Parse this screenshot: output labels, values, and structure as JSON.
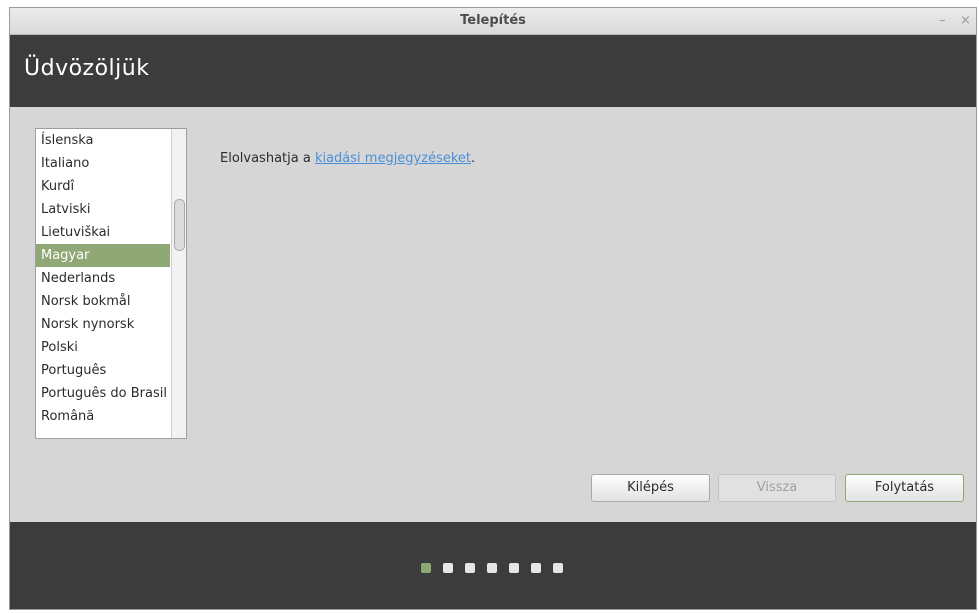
{
  "window": {
    "title": "Telepítés",
    "minimize_glyph": "–",
    "close_glyph": "×"
  },
  "header": {
    "heading": "Üdvözöljük"
  },
  "language_list": {
    "items": [
      {
        "label": "Íslenska"
      },
      {
        "label": "Italiano"
      },
      {
        "label": "Kurdî"
      },
      {
        "label": "Latviski"
      },
      {
        "label": "Lietuviškai"
      },
      {
        "label": "Magyar",
        "selected": true
      },
      {
        "label": "Nederlands"
      },
      {
        "label": "Norsk bokmål"
      },
      {
        "label": "Norsk nynorsk"
      },
      {
        "label": "Polski"
      },
      {
        "label": "Português"
      },
      {
        "label": "Português do Brasil"
      },
      {
        "label": "Română"
      }
    ],
    "selected": "Magyar"
  },
  "release_notes": {
    "prefix": "Elolvashatja a ",
    "link_text": "kiadási megjegyzéseket",
    "suffix": "."
  },
  "buttons": {
    "quit": "Kilépés",
    "back": "Vissza",
    "continue": "Folytatás"
  },
  "progress": {
    "total_steps": 7,
    "current_step": 1
  },
  "colors": {
    "accent": "#8fa876",
    "header_bg": "#3c3c3c",
    "link": "#4a90d9"
  }
}
